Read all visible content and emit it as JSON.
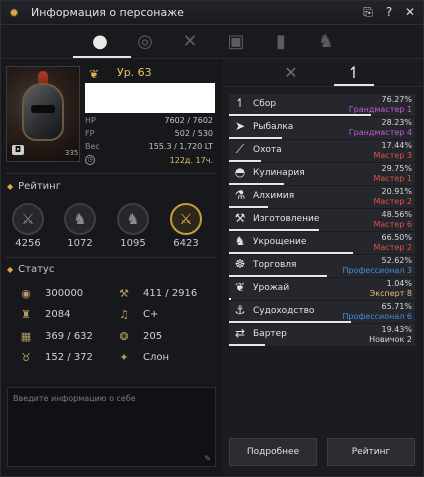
{
  "window": {
    "title": "Информация о персонаже"
  },
  "top_tabs": [
    {
      "icon": "profile-icon",
      "active": true
    },
    {
      "icon": "medal-icon"
    },
    {
      "icon": "combat-icon"
    },
    {
      "icon": "gift-icon"
    },
    {
      "icon": "chart-icon"
    },
    {
      "icon": "horse-icon"
    }
  ],
  "profile": {
    "level": "Ур. 63",
    "hp_label": "HP",
    "hp_value": "7602 / 7602",
    "fp_label": "FP",
    "fp_value": "502 / 530",
    "weight_label": "Вес",
    "weight_value": "155.3 / 1,720 LT",
    "time_value": "122д. 17ч.",
    "portrait_number": "335"
  },
  "rating": {
    "title": "Рейтинг",
    "items": [
      {
        "icon": "swords-icon",
        "value": "4256",
        "gold": false
      },
      {
        "icon": "horse-head-icon",
        "value": "1072",
        "gold": false
      },
      {
        "icon": "horse-head-icon",
        "value": "1095",
        "gold": false
      },
      {
        "icon": "crossed-swords-icon",
        "value": "6423",
        "gold": true
      }
    ]
  },
  "status": {
    "title": "Статус",
    "items": [
      {
        "icon": "coins-icon",
        "value": "300000"
      },
      {
        "icon": "hammer-icon",
        "value": "411 / 2916"
      },
      {
        "icon": "contribution-icon",
        "value": "2084"
      },
      {
        "icon": "music-icon",
        "value": "C+"
      },
      {
        "icon": "inventory-icon",
        "value": "369 / 632"
      },
      {
        "icon": "energy-icon",
        "value": "205"
      },
      {
        "icon": "weight-icon",
        "value": "152 / 372"
      },
      {
        "icon": "constellation-icon",
        "value": "Слон"
      }
    ]
  },
  "intro": {
    "placeholder": "Введите информацию о себе"
  },
  "right_tabs": [
    {
      "icon": "combat-icon",
      "active": false
    },
    {
      "icon": "sickle-icon",
      "active": true
    }
  ],
  "life_skills": [
    {
      "name": "Сбор",
      "percent": "76.27%",
      "grade": "Грандмастер 1",
      "grade_color": "#c05bd8",
      "progress": 0.7627,
      "icon": "sickle-icon"
    },
    {
      "name": "Рыбалка",
      "percent": "28.23%",
      "grade": "Грандмастер 4",
      "grade_color": "#c05bd8",
      "progress": 0.2823,
      "icon": "fish-icon"
    },
    {
      "name": "Охота",
      "percent": "17.44%",
      "grade": "Мастер 3",
      "grade_color": "#e0514b",
      "progress": 0.1744,
      "icon": "rifle-icon"
    },
    {
      "name": "Кулинария",
      "percent": "29.75%",
      "grade": "Мастер 1",
      "grade_color": "#e0514b",
      "progress": 0.2975,
      "icon": "cooking-icon"
    },
    {
      "name": "Алхимия",
      "percent": "20.91%",
      "grade": "Мастер 2",
      "grade_color": "#e0514b",
      "progress": 0.2091,
      "icon": "alchemy-icon"
    },
    {
      "name": "Изготовление",
      "percent": "48.56%",
      "grade": "Мастер 6",
      "grade_color": "#e0514b",
      "progress": 0.4856,
      "icon": "hammer-icon"
    },
    {
      "name": "Укрощение",
      "percent": "66.50%",
      "grade": "Мастер 2",
      "grade_color": "#e0514b",
      "progress": 0.665,
      "icon": "horse-icon"
    },
    {
      "name": "Торговля",
      "percent": "52.62%",
      "grade": "Профессионал 3",
      "grade_color": "#3f8fe0",
      "progress": 0.5262,
      "icon": "trade-icon"
    },
    {
      "name": "Урожай",
      "percent": "1.04%",
      "grade": "Эксперт 8",
      "grade_color": "#e3c163",
      "progress": 0.0104,
      "icon": "sprout-icon"
    },
    {
      "name": "Судоходство",
      "percent": "65.71%",
      "grade": "Профессионал 6",
      "grade_color": "#3f8fe0",
      "progress": 0.6571,
      "icon": "anchor-icon"
    },
    {
      "name": "Бартер",
      "percent": "19.43%",
      "grade": "Новичок 2",
      "grade_color": "#d7d7d7",
      "progress": 0.1943,
      "icon": "barter-icon"
    }
  ],
  "buttons": {
    "details": "Подробнее",
    "ranking": "Рейтинг"
  }
}
